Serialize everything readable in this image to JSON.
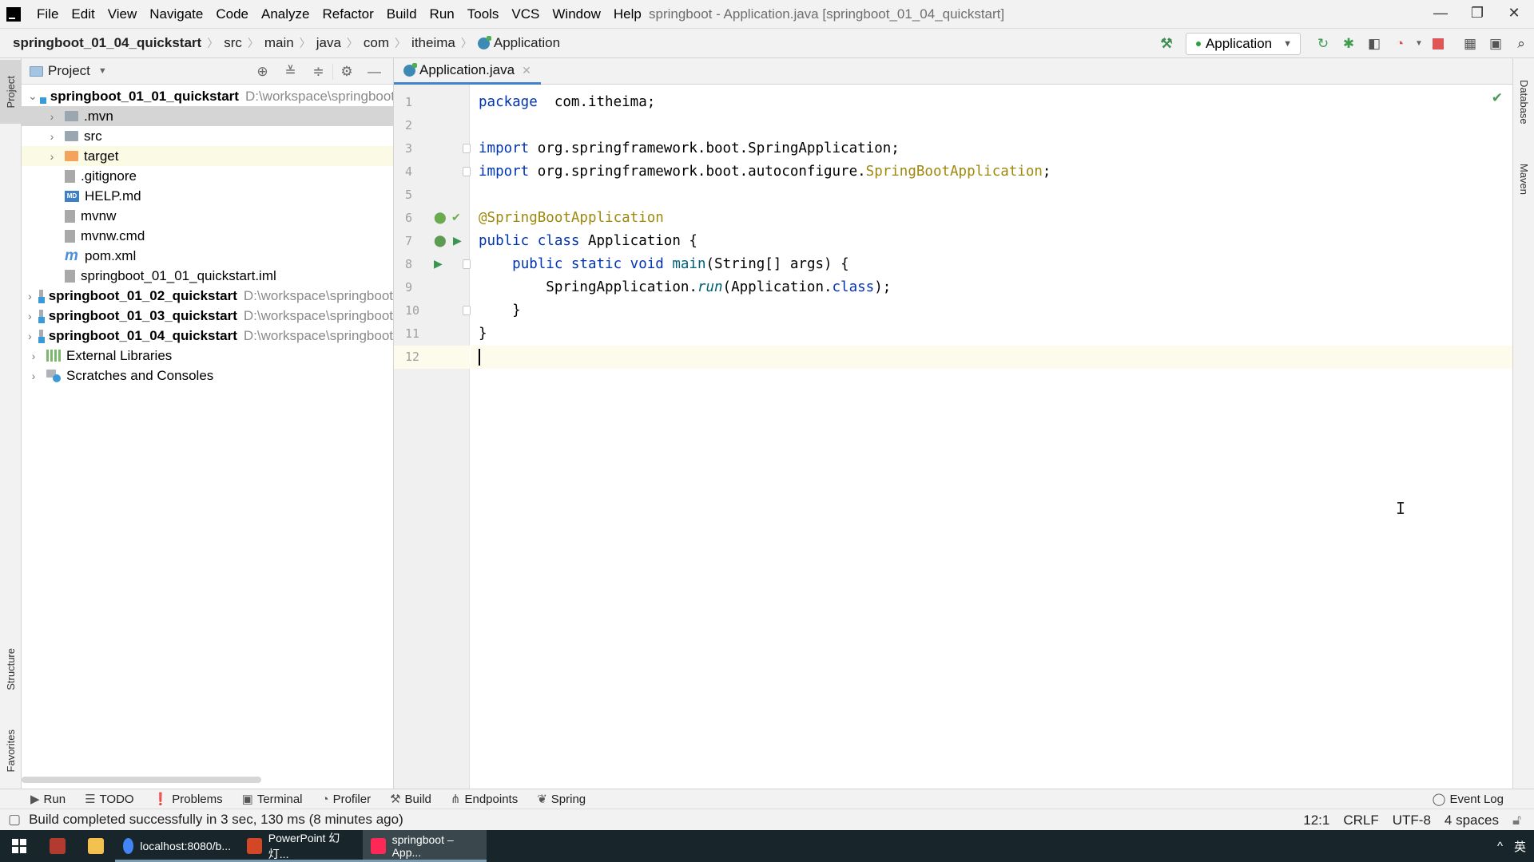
{
  "window": {
    "title": "springboot - Application.java [springboot_01_04_quickstart]",
    "controls": {
      "minimize": "—",
      "restore": "❐",
      "close": "✕"
    }
  },
  "menu": [
    "File",
    "Edit",
    "View",
    "Navigate",
    "Code",
    "Analyze",
    "Refactor",
    "Build",
    "Run",
    "Tools",
    "VCS",
    "Window",
    "Help"
  ],
  "breadcrumb": {
    "project": "springboot_01_04_quickstart",
    "parts": [
      "src",
      "main",
      "java",
      "com",
      "itheima"
    ],
    "file": "Application"
  },
  "toolbar": {
    "run_config": "Application",
    "icons": [
      "build-hammer-icon",
      "rerun-icon",
      "debug-icon",
      "coverage-icon",
      "profiler-icon",
      "stop-icon",
      "project-structure-icon",
      "terminal-window-icon",
      "search-icon"
    ]
  },
  "left_stripe": {
    "top": "Project",
    "structure": "Structure",
    "favorites": "Favorites"
  },
  "right_stripe": {
    "database": "Database",
    "maven": "Maven"
  },
  "project_panel": {
    "title": "Project",
    "tree": [
      {
        "label": "springboot_01_01_quickstart",
        "path": "D:\\workspace\\springboot",
        "level": 0,
        "expanded": true,
        "type": "module",
        "bold": true
      },
      {
        "label": ".mvn",
        "level": 1,
        "type": "folder",
        "collapsed": true,
        "selected": true
      },
      {
        "label": "src",
        "level": 1,
        "type": "folder",
        "collapsed": true
      },
      {
        "label": "target",
        "level": 1,
        "type": "folder-excluded",
        "collapsed": true,
        "highlighted": true
      },
      {
        "label": ".gitignore",
        "level": 1,
        "type": "gitignore"
      },
      {
        "label": "HELP.md",
        "level": 1,
        "type": "markdown"
      },
      {
        "label": "mvnw",
        "level": 1,
        "type": "shell"
      },
      {
        "label": "mvnw.cmd",
        "level": 1,
        "type": "file"
      },
      {
        "label": "pom.xml",
        "level": 1,
        "type": "maven"
      },
      {
        "label": "springboot_01_01_quickstart.iml",
        "level": 1,
        "type": "iml"
      },
      {
        "label": "springboot_01_02_quickstart",
        "path": "D:\\workspace\\springboot",
        "level": 0,
        "collapsed": true,
        "type": "module",
        "bold": true
      },
      {
        "label": "springboot_01_03_quickstart",
        "path": "D:\\workspace\\springboot",
        "level": 0,
        "collapsed": true,
        "type": "module",
        "bold": true
      },
      {
        "label": "springboot_01_04_quickstart",
        "path": "D:\\workspace\\springboot",
        "level": 0,
        "collapsed": true,
        "type": "module",
        "bold": true
      },
      {
        "label": "External Libraries",
        "level": 0,
        "collapsed": true,
        "type": "libraries"
      },
      {
        "label": "Scratches and Consoles",
        "level": 0,
        "collapsed": true,
        "type": "scratches"
      }
    ]
  },
  "editor": {
    "tab": "Application.java",
    "lines": [
      {
        "n": "1",
        "segs": [
          [
            "kw",
            "package"
          ],
          [
            "",
            "  com.itheima;"
          ]
        ]
      },
      {
        "n": "2",
        "segs": []
      },
      {
        "n": "3",
        "segs": [
          [
            "kw",
            "import"
          ],
          [
            "",
            " org.springframework.boot.SpringApplication;"
          ]
        ]
      },
      {
        "n": "4",
        "segs": [
          [
            "kw",
            "import"
          ],
          [
            "",
            " org.springframework.boot.autoconfigure."
          ],
          [
            "ann",
            "SpringBootApplication"
          ],
          [
            "",
            ";"
          ]
        ]
      },
      {
        "n": "5",
        "segs": []
      },
      {
        "n": "6",
        "segs": [
          [
            "ann",
            "@SpringBootApplication"
          ]
        ]
      },
      {
        "n": "7",
        "segs": [
          [
            "kw",
            "public class"
          ],
          [
            "",
            " Application {"
          ]
        ]
      },
      {
        "n": "8",
        "segs": [
          [
            "",
            "    "
          ],
          [
            "kw",
            "public static void"
          ],
          [
            "",
            " "
          ],
          [
            "mth",
            "main"
          ],
          [
            "",
            "(String[] args) {"
          ]
        ]
      },
      {
        "n": "9",
        "segs": [
          [
            "",
            "        SpringApplication."
          ],
          [
            "it",
            "run"
          ],
          [
            "",
            "(Application."
          ],
          [
            "kw",
            "class"
          ],
          [
            "",
            ");"
          ]
        ]
      },
      {
        "n": "10",
        "segs": [
          [
            "",
            "    }"
          ]
        ]
      },
      {
        "n": "11",
        "segs": [
          [
            "",
            "}"
          ]
        ]
      },
      {
        "n": "12",
        "segs": [],
        "current": true
      }
    ]
  },
  "tool_tabs": [
    {
      "label": "Run",
      "icon": "run-icon"
    },
    {
      "label": "TODO",
      "icon": "todo-icon"
    },
    {
      "label": "Problems",
      "icon": "problems-icon"
    },
    {
      "label": "Terminal",
      "icon": "terminal-icon"
    },
    {
      "label": "Profiler",
      "icon": "profiler-icon"
    },
    {
      "label": "Build",
      "icon": "build-icon"
    },
    {
      "label": "Endpoints",
      "icon": "endpoints-icon"
    },
    {
      "label": "Spring",
      "icon": "spring-icon"
    }
  ],
  "event_log": "Event Log",
  "status": {
    "message": "Build completed successfully in 3 sec, 130 ms (8 minutes ago)",
    "position": "12:1",
    "line_sep": "CRLF",
    "encoding": "UTF-8",
    "indent": "4 spaces"
  },
  "taskbar": {
    "items": [
      {
        "label": "",
        "icon": "app-red-icon"
      },
      {
        "label": "",
        "icon": "file-explorer-icon"
      },
      {
        "label": "localhost:8080/b...",
        "icon": "chrome-icon"
      },
      {
        "label": "PowerPoint 幻灯...",
        "icon": "powerpoint-icon"
      },
      {
        "label": "springboot – App...",
        "icon": "intellij-icon",
        "active": true
      }
    ],
    "tray": {
      "chevron": "^",
      "ime": "英"
    }
  }
}
